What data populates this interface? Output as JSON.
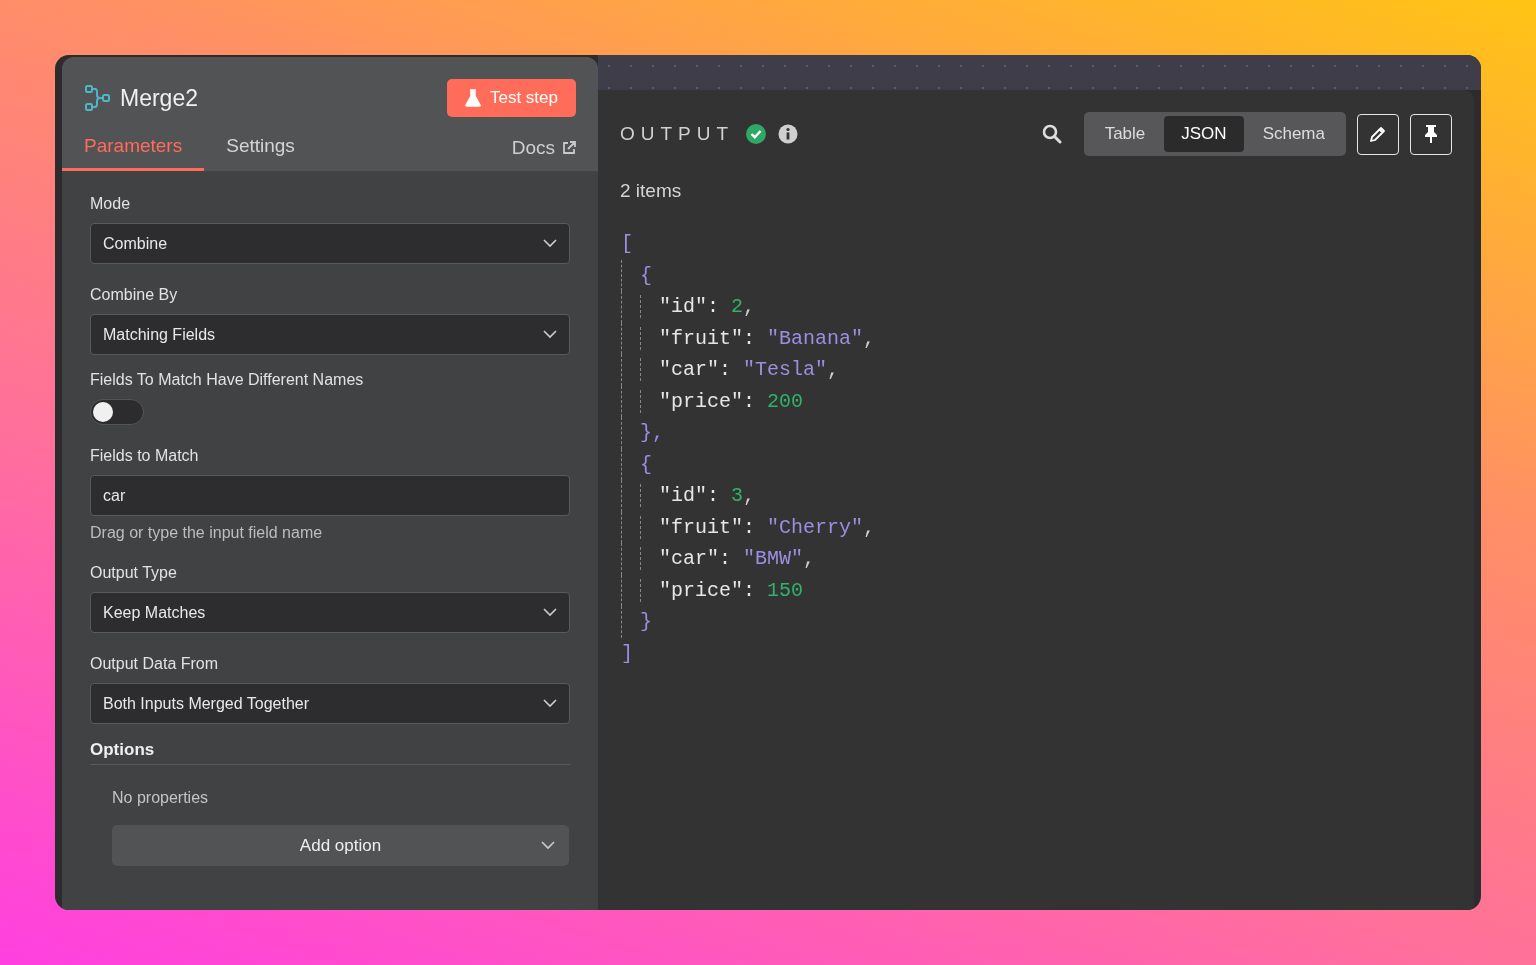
{
  "node": {
    "title": "Merge2",
    "test_button": "Test step"
  },
  "tabs": [
    {
      "label": "Parameters",
      "selected": true
    },
    {
      "label": "Settings",
      "selected": false
    }
  ],
  "docs_link": "Docs",
  "parameters": [
    {
      "kind": "select",
      "label": "Mode",
      "value": "Combine"
    },
    {
      "kind": "select",
      "label": "Combine By",
      "value": "Matching Fields"
    },
    {
      "kind": "toggle",
      "label": "Fields To Match Have Different Names",
      "on": false
    },
    {
      "kind": "text",
      "label": "Fields to Match",
      "value": "car",
      "hint": "Drag or type the input field name"
    },
    {
      "kind": "select",
      "label": "Output Type",
      "value": "Keep Matches"
    },
    {
      "kind": "select",
      "label": "Output Data From",
      "value": "Both Inputs Merged Together"
    }
  ],
  "options": {
    "title": "Options",
    "empty_text": "No properties",
    "add_button": "Add option"
  },
  "output": {
    "title": "OUTPUT",
    "success": true,
    "items_count": "2 items",
    "views": [
      {
        "label": "Table",
        "selected": false
      },
      {
        "label": "JSON",
        "selected": true
      },
      {
        "label": "Schema",
        "selected": false
      }
    ],
    "json_view": {
      "open": "[",
      "close": "]",
      "records": [
        {
          "open": "{",
          "close": "},",
          "fields": [
            {
              "key": "\"id\":",
              "value": "2",
              "sep": ",",
              "kind": "number"
            },
            {
              "key": "\"fruit\":",
              "value": "\"Banana\"",
              "sep": ",",
              "kind": "string"
            },
            {
              "key": "\"car\":",
              "value": "\"Tesla\"",
              "sep": ",",
              "kind": "string"
            },
            {
              "key": "\"price\":",
              "value": "200",
              "kind": "number"
            }
          ]
        },
        {
          "open": "{",
          "close": "}",
          "fields": [
            {
              "key": "\"id\":",
              "value": "3",
              "sep": ",",
              "kind": "number"
            },
            {
              "key": "\"fruit\":",
              "value": "\"Cherry\"",
              "sep": ",",
              "kind": "string"
            },
            {
              "key": "\"car\":",
              "value": "\"BMW\"",
              "sep": ",",
              "kind": "string"
            },
            {
              "key": "\"price\":",
              "value": "150",
              "kind": "number"
            }
          ]
        }
      ]
    }
  }
}
